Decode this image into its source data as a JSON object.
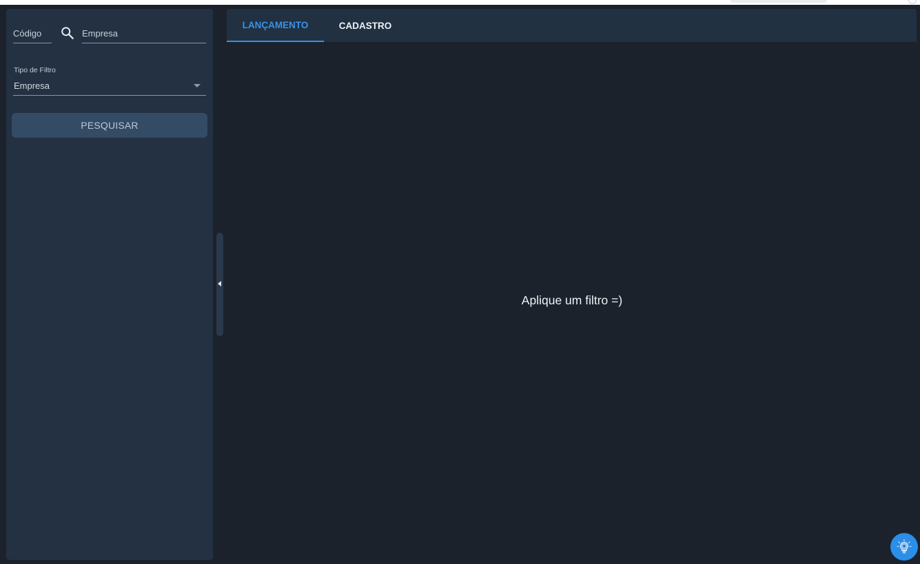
{
  "sidebar": {
    "codigo_placeholder": "Código",
    "empresa_placeholder": "Empresa",
    "filter_label": "Tipo de Filtro",
    "filter_value": "Empresa",
    "search_button": "PESQUISAR"
  },
  "tabs": [
    {
      "label": "LANÇAMENTO",
      "active": true
    },
    {
      "label": "CADASTRO",
      "active": false
    }
  ],
  "main": {
    "empty_message": "Aplique um filtro =)"
  },
  "colors": {
    "accent": "#3a92e6",
    "background": "#1b222c",
    "panel": "#233142",
    "fab": "#2b8ee8"
  },
  "icons": {
    "search": "search-icon",
    "collapse": "chevron-left-icon",
    "help": "lightbulb-icon",
    "dropdown": "caret-down-icon"
  }
}
